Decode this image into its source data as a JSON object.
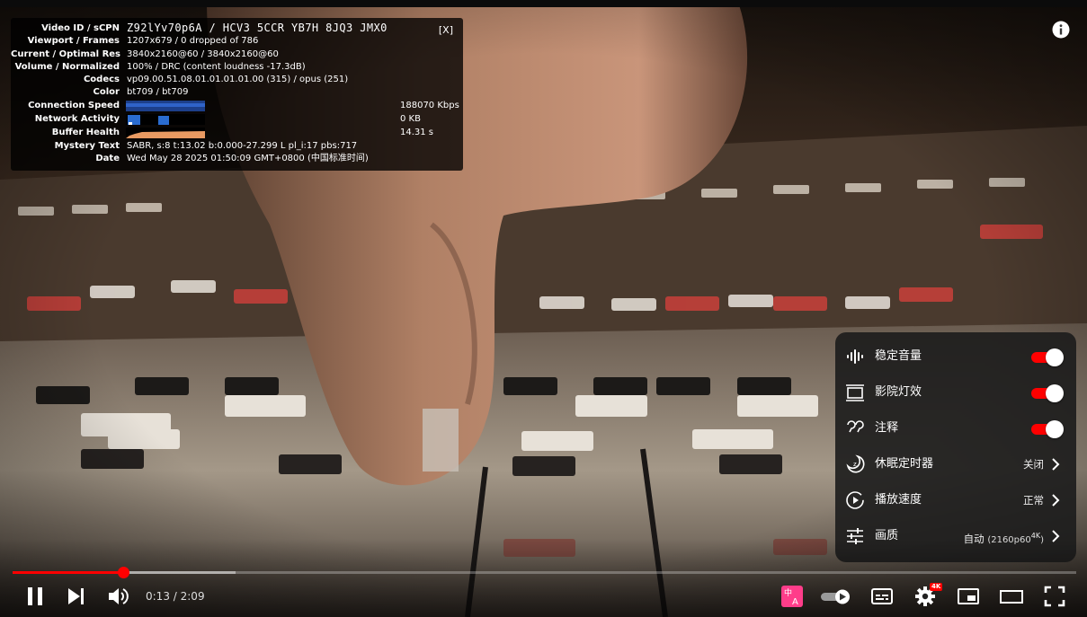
{
  "stats_panel": {
    "close_label": "[X]",
    "rows": [
      {
        "label": "Video ID / sCPN",
        "value": "Z92lYv70p6A / HCV3 5CCR YB7H 8JQ3 JMX0"
      },
      {
        "label": "Viewport / Frames",
        "value": "1207x679 / 0 dropped of 786"
      },
      {
        "label": "Current / Optimal Res",
        "value": "3840x2160@60 / 3840x2160@60"
      },
      {
        "label": "Volume / Normalized",
        "value": "100% / DRC (content loudness -17.3dB)"
      },
      {
        "label": "Codecs",
        "value": "vp09.00.51.08.01.01.01.01.00 (315) / opus (251)"
      },
      {
        "label": "Color",
        "value": "bt709 / bt709"
      },
      {
        "label": "Connection Speed",
        "value": "188070 Kbps"
      },
      {
        "label": "Network Activity",
        "value": "0 KB"
      },
      {
        "label": "Buffer Health",
        "value": "14.31 s"
      },
      {
        "label": "Mystery Text",
        "value": "SABR, s:8 t:13.02 b:0.000-27.299 L pl_i:17 pbs:717"
      },
      {
        "label": "Date",
        "value": "Wed May 28 2025 01:50:09 GMT+0800 (中国标准时间)"
      }
    ]
  },
  "settings_menu": {
    "items": [
      {
        "label": "稳定音量",
        "icon": "stable-volume-icon",
        "type": "toggle",
        "on": true
      },
      {
        "label": "影院灯效",
        "icon": "ambient-mode-icon",
        "type": "toggle",
        "on": true
      },
      {
        "label": "注释",
        "icon": "annotations-icon",
        "type": "toggle",
        "on": true
      },
      {
        "label": "休眠定时器",
        "icon": "sleep-timer-icon",
        "type": "submenu",
        "value": "关闭"
      },
      {
        "label": "播放速度",
        "icon": "playback-speed-icon",
        "type": "submenu",
        "value": "正常"
      },
      {
        "label": "画质",
        "icon": "quality-icon",
        "type": "submenu",
        "value": "自动",
        "value_detail": "(2160p60",
        "value_badge": "4K",
        "value_close": ")"
      }
    ]
  },
  "player": {
    "time_current": "0:13",
    "time_total": "2:09",
    "time_separator": " / ",
    "progress_played_fraction": 0.104,
    "progress_buffered_fraction": 0.21,
    "settings_badge": "4K",
    "accent_color": "#ff0000"
  }
}
